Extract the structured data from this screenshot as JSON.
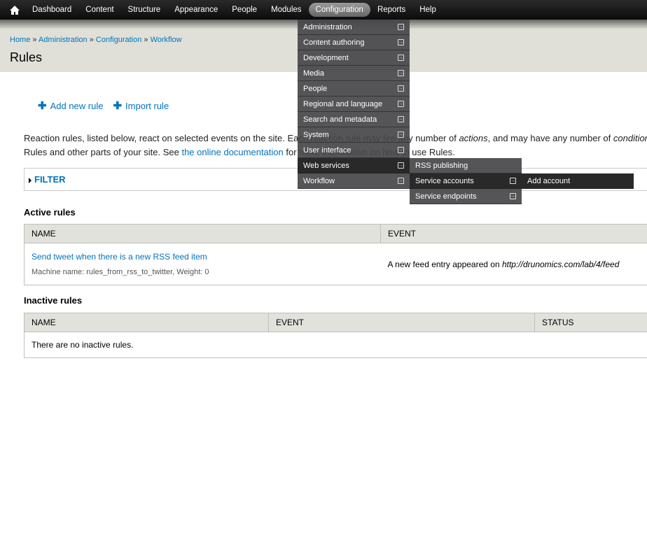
{
  "toolbar": {
    "items": [
      "Dashboard",
      "Content",
      "Structure",
      "Appearance",
      "People",
      "Modules",
      "Configuration",
      "Reports",
      "Help"
    ],
    "active": "Configuration",
    "home_icon": "home-icon"
  },
  "breadcrumb": [
    "Home",
    "Administration",
    "Configuration",
    "Workflow"
  ],
  "page_title": "Rules",
  "actions": {
    "add": "Add new rule",
    "import": "Import rule"
  },
  "description": {
    "line1a": "Reaction rules, listed below, react on selected events on the site. Each reaction rule may fire any number of ",
    "actions": "actions",
    "line1b": ", and may have any number of ",
    "conditions": "conditions",
    "line2a": "Rules and other parts of your site. See ",
    "link": "the online documentation",
    "line2b": " for more information on how to use Rules."
  },
  "filter": "FILTER",
  "active_rules": {
    "heading": "Active rules",
    "columns": [
      "NAME",
      "EVENT"
    ],
    "rows": [
      {
        "name": "Send tweet when there is a new RSS feed item",
        "machine": "Machine name: rules_from_rss_to_twitter, Weight: 0",
        "event_text": "A new feed entry appeared on ",
        "event_url": "http://drunomics.com/lab/4/feed"
      }
    ]
  },
  "inactive_rules": {
    "heading": "Inactive rules",
    "columns": [
      "NAME",
      "EVENT",
      "STATUS"
    ],
    "empty": "There are no inactive rules."
  },
  "menu": {
    "config": [
      "Administration",
      "Content authoring",
      "Development",
      "Media",
      "People",
      "Regional and language",
      "Search and metadata",
      "System",
      "User interface",
      "Web services",
      "Workflow"
    ],
    "web_services": [
      "RSS publishing",
      "Service accounts",
      "Service endpoints"
    ],
    "service_accounts": [
      "Add account"
    ]
  }
}
